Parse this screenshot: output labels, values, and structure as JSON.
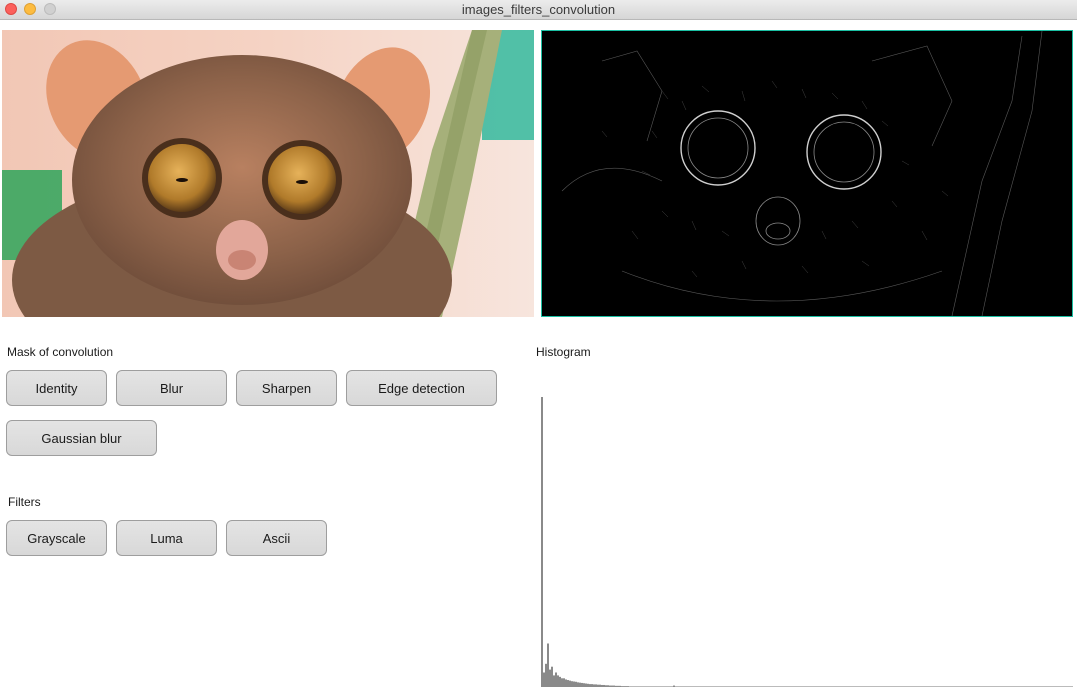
{
  "window": {
    "title": "images_filters_convolution"
  },
  "mask_section": {
    "label": "Mask of convolution",
    "buttons": [
      "Identity",
      "Blur",
      "Sharpen",
      "Edge detection",
      "Gaussian blur"
    ]
  },
  "filters_section": {
    "label": "Filters",
    "buttons": [
      "Grayscale",
      "Luma",
      "Ascii"
    ]
  },
  "histogram": {
    "label": "Histogram",
    "bar_color": "#8a8a8a",
    "chart_data": {
      "type": "bar",
      "values": [
        100,
        5,
        8,
        15,
        6,
        7,
        4,
        5,
        4,
        3.5,
        3,
        3,
        2.6,
        2.4,
        2.2,
        2,
        1.9,
        1.8,
        1.6,
        1.5,
        1.4,
        1.3,
        1.2,
        1.1,
        1,
        1,
        0.9,
        0.9,
        0.8,
        0.8,
        0.7,
        0.7,
        0.6,
        0.6,
        0.5,
        0.5,
        0.5,
        0.4,
        0.4,
        0.4,
        0.3,
        0.3,
        0.3,
        0.3,
        0.2,
        0.2,
        0.2,
        0.2,
        0.2,
        0.2,
        0.2,
        0.2,
        0.2,
        0.2,
        0.2,
        0.2,
        0.2,
        0.2,
        0.2,
        0.2,
        0.2,
        0.2,
        0.2,
        0.2,
        0.2,
        0.2,
        0.5,
        0.2,
        0.2,
        0.2,
        0.2,
        0.2,
        0.2,
        0.2,
        0.2,
        0.2,
        0.2,
        0.2,
        0.2,
        0.2,
        0.2,
        0.2,
        0.2,
        0.2,
        0.2,
        0.2,
        0.2,
        0.2,
        0.2,
        0.2,
        0.2,
        0.2,
        0.2,
        0.2,
        0.2,
        0.2,
        0.2,
        0.2,
        0.2,
        0.2,
        0.2,
        0.2,
        0.2,
        0.2,
        0.2,
        0.2,
        0.2,
        0.2,
        0.2,
        0.2,
        0.2,
        0.2,
        0.2,
        0.2,
        0.2,
        0.2,
        0.2,
        0.2,
        0.2,
        0.2,
        0.2,
        0.2,
        0.2,
        0.2,
        0.2,
        0.2,
        0.2,
        0.2,
        0.2,
        0.2,
        0.2,
        0.2,
        0.2,
        0.2,
        0.2,
        0.2,
        0.2,
        0.2,
        0.2,
        0.2,
        0.2,
        0.2,
        0.2,
        0.2,
        0.2,
        0.2,
        0.2,
        0.2,
        0.2,
        0.2,
        0.2,
        0.2,
        0.2,
        0.2,
        0.2,
        0.2,
        0.2,
        0.2,
        0.2,
        0.2,
        0.2,
        0.2,
        0.2,
        0.2,
        0.2,
        0.2,
        0.2,
        0.2,
        0.2,
        0.2,
        0.2,
        0.2,
        0.2,
        0.2,
        0.2,
        0.2,
        0.2,
        0.2,
        0.2,
        0.2,
        0.2,
        0.2,
        0.2,
        0.2,
        0.2,
        0.2,
        0.2,
        0.2,
        0.2,
        0.2,
        0.2,
        0.2,
        0.2,
        0.2,
        0.2,
        0.2,
        0.2,
        0.2,
        0.2,
        0.2,
        0.2,
        0.2,
        0.2,
        0.2,
        0.2,
        0.2,
        0.2,
        0.2,
        0.2,
        0.2,
        0.2,
        0.2,
        0.2,
        0.2,
        0.2,
        0.2,
        0.2,
        0.2,
        0.2,
        0.2,
        0.2,
        0.2,
        0.2,
        0.2,
        0.2,
        0.2,
        0.2,
        0.2,
        0.2,
        0.2,
        0.2,
        0.2,
        0.2,
        0.2,
        0.2,
        0.2,
        0.2,
        0.2,
        0.2,
        0.2,
        0.2,
        0.2,
        0.2,
        0.2,
        0.2,
        0.2,
        0.2,
        0.2,
        0.2,
        0.2,
        0.2,
        0.2,
        0.2,
        0.2,
        0.2,
        0.2,
        0.2,
        0.2,
        0.2,
        0.2,
        0.2,
        0.2,
        0.2,
        0.2,
        0.2,
        0.2
      ],
      "ylim": [
        0,
        100
      ]
    }
  },
  "images": {
    "original_alt_icon": "tarsier-photo",
    "filtered_alt_icon": "edge-detected-tarsier-photo"
  }
}
